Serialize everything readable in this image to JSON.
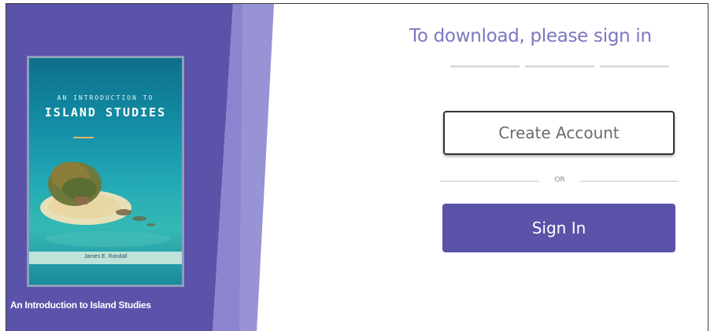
{
  "book": {
    "cover_subtitle": "AN INTRODUCTION TO",
    "cover_title": "ISLAND STUDIES",
    "cover_author": "James E. Randall",
    "caption": "An Introduction to Island Studies"
  },
  "signin": {
    "heading": "To download, please sign in",
    "create_account_label": "Create Account",
    "or_label": "OR",
    "sign_in_label": "Sign In"
  },
  "colors": {
    "panel_purple": "#5b52a9",
    "heading_purple": "#7b76c0",
    "button_purple": "#5b52a9"
  }
}
